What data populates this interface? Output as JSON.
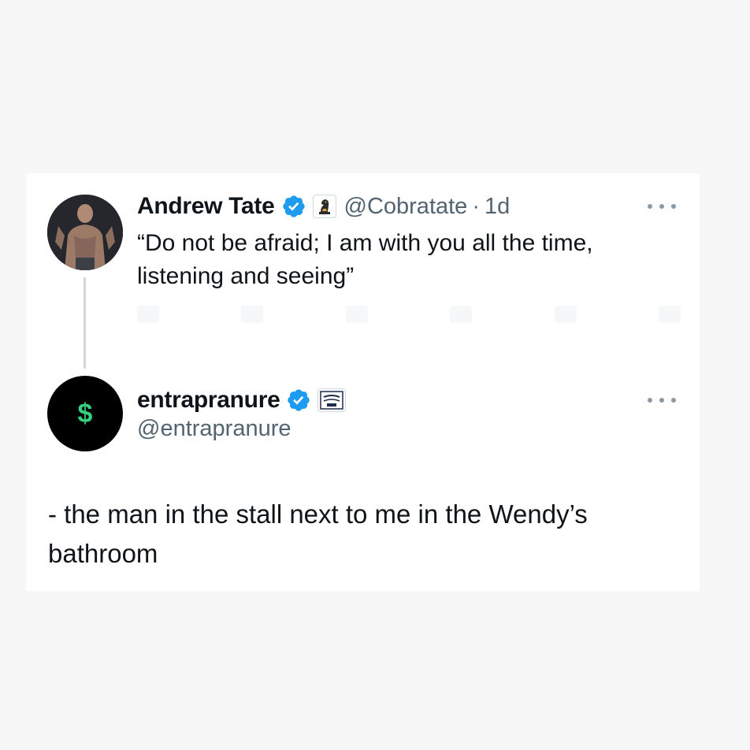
{
  "quoted_tweet": {
    "author_name": "Andrew Tate",
    "handle": "@Cobratate",
    "separator": "·",
    "time": "1d",
    "text": "“Do not be afraid; I am with you all the time, listening and seeing”",
    "verified_icon": "verified-badge-icon",
    "affiliation_icon": "chess-knight-icon"
  },
  "main_tweet": {
    "author_name": "entrapranure",
    "handle": "@entrapranure",
    "avatar_symbol": "$",
    "text": "- the man in the stall next to me in the Wendy’s bathroom",
    "verified_icon": "verified-badge-icon",
    "affiliation_icon": "barstool-logo-icon"
  },
  "colors": {
    "verified_blue": "#1d9bf0",
    "muted_text": "#536471",
    "dollar_green": "#35d07f"
  }
}
